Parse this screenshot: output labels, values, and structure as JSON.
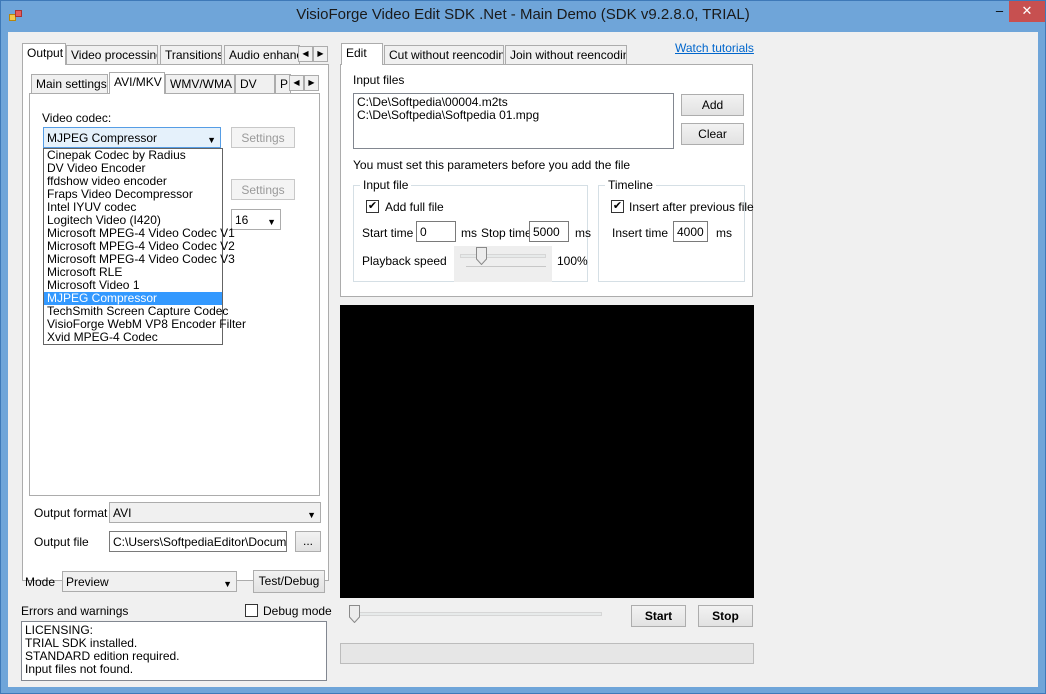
{
  "window": {
    "title": "VisioForge Video Edit SDK .Net - Main Demo (SDK v9.2.8.0, TRIAL)",
    "minimize": "–",
    "close": "✕"
  },
  "left_tabs": [
    "Output",
    "Video processing",
    "Transitions",
    "Audio enhance"
  ],
  "output_subtabs": [
    "Main settings",
    "AVI/MKV",
    "WMV/WMA",
    "DV",
    "P"
  ],
  "avi": {
    "video_codec_label": "Video codec:",
    "video_codec_value": "MJPEG Compressor",
    "settings_label": "Settings",
    "settings2_label": "Settings",
    "bits_value": "16",
    "codec_options": [
      "Cinepak Codec by Radius",
      "DV Video Encoder",
      "ffdshow video encoder",
      "Fraps Video Decompressor",
      "Intel IYUV codec",
      "Logitech Video (I420)",
      "Microsoft MPEG-4 Video Codec V1",
      "Microsoft MPEG-4 Video Codec V2",
      "Microsoft MPEG-4 Video Codec V3",
      "Microsoft RLE",
      "Microsoft Video 1",
      "MJPEG Compressor",
      "TechSmith Screen Capture Codec",
      "VisioForge WebM VP8 Encoder Filter",
      "Xvid MPEG-4 Codec"
    ],
    "selected_index": 11
  },
  "output": {
    "format_label": "Output format",
    "format_value": "AVI",
    "file_label": "Output file",
    "file_value": "C:\\Users\\SoftpediaEditor\\Document",
    "browse_label": "..."
  },
  "mode": {
    "label": "Mode",
    "value": "Preview",
    "test_debug_label": "Test/Debug"
  },
  "errors": {
    "label": "Errors and warnings",
    "debug_mode_label": "Debug mode",
    "debug_mode_checked": false,
    "lines": [
      "LICENSING:",
      "TRIAL SDK installed.",
      "STANDARD edition required.",
      "Input files not found."
    ]
  },
  "right_tabs": [
    "Edit",
    "Cut without reencoding",
    "Join without reencoding"
  ],
  "watch_tutorials": "Watch tutorials",
  "edit": {
    "input_files_label": "Input files",
    "files": [
      "C:\\De\\Softpedia\\00004.m2ts",
      "C:\\De\\Softpedia\\Softpedia 01.mpg"
    ],
    "add_label": "Add",
    "clear_label": "Clear",
    "notice": "You must set this parameters before you add the file",
    "input_file_group": "Input file",
    "add_full_file_label": "Add full file",
    "add_full_file_checked": true,
    "start_time_label": "Start time",
    "start_time_value": "0",
    "ms1": "ms",
    "stop_time_label": "Stop time",
    "stop_time_value": "5000",
    "ms2": "ms",
    "playback_speed_label": "Playback speed",
    "playback_speed_value": "100%",
    "timeline_group": "Timeline",
    "insert_after_label": "Insert after previous file",
    "insert_after_checked": true,
    "insert_time_label": "Insert time",
    "insert_time_value": "4000",
    "ms3": "ms"
  },
  "player": {
    "start_label": "Start",
    "stop_label": "Stop",
    "position": 0,
    "progress": 0
  },
  "colors": {
    "titlebar": "#6fa5d9",
    "selection": "#3399ff",
    "link": "#0066cc"
  }
}
